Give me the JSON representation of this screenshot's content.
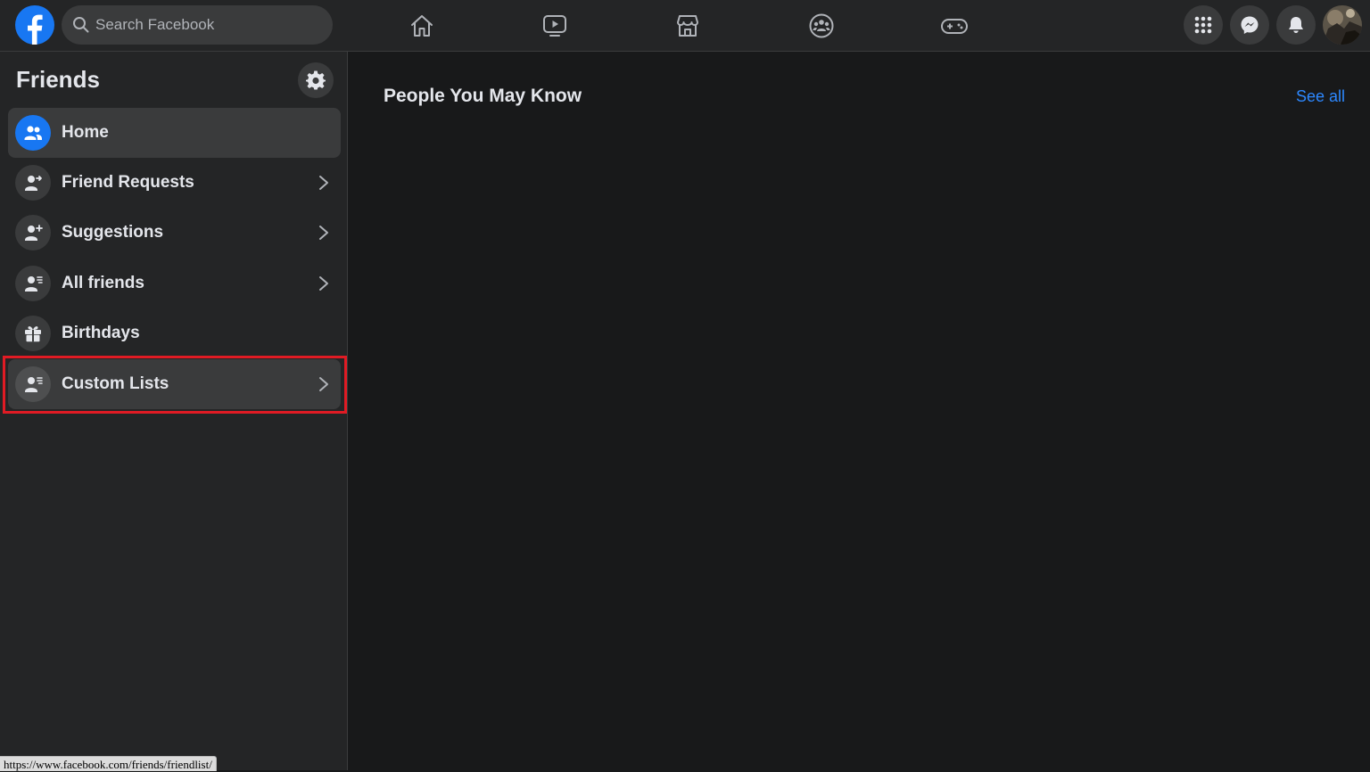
{
  "header": {
    "logo_icon": "facebook-logo",
    "search": {
      "placeholder": "Search Facebook",
      "value": ""
    },
    "nav_tabs": [
      {
        "name": "home",
        "icon": "home-icon"
      },
      {
        "name": "watch",
        "icon": "video-play-icon"
      },
      {
        "name": "marketplace",
        "icon": "storefront-icon"
      },
      {
        "name": "groups",
        "icon": "groups-icon"
      },
      {
        "name": "gaming",
        "icon": "gamepad-icon"
      }
    ],
    "right_buttons": [
      {
        "name": "menu",
        "icon": "grid-icon"
      },
      {
        "name": "messenger",
        "icon": "messenger-icon"
      },
      {
        "name": "notifications",
        "icon": "bell-icon"
      }
    ]
  },
  "sidebar": {
    "title": "Friends",
    "settings_icon": "gear-icon",
    "items": [
      {
        "label": "Home",
        "icon": "friends-icon",
        "active": true,
        "chevron": false
      },
      {
        "label": "Friend Requests",
        "icon": "person-arrow-icon",
        "chevron": true
      },
      {
        "label": "Suggestions",
        "icon": "person-plus-icon",
        "chevron": true
      },
      {
        "label": "All friends",
        "icon": "person-list-icon",
        "chevron": true
      },
      {
        "label": "Birthdays",
        "icon": "gift-icon",
        "chevron": false
      },
      {
        "label": "Custom Lists",
        "icon": "person-list-icon",
        "chevron": true,
        "highlighted": true
      }
    ]
  },
  "main": {
    "heading": "People You May Know",
    "see_all": "See all"
  },
  "status_bar": {
    "url": "https://www.facebook.com/friends/friendlist/"
  },
  "colors": {
    "accent": "#1877f2",
    "link": "#2d88ff",
    "background": "#18191a",
    "surface": "#242526",
    "highlight_border": "#e01b24"
  }
}
